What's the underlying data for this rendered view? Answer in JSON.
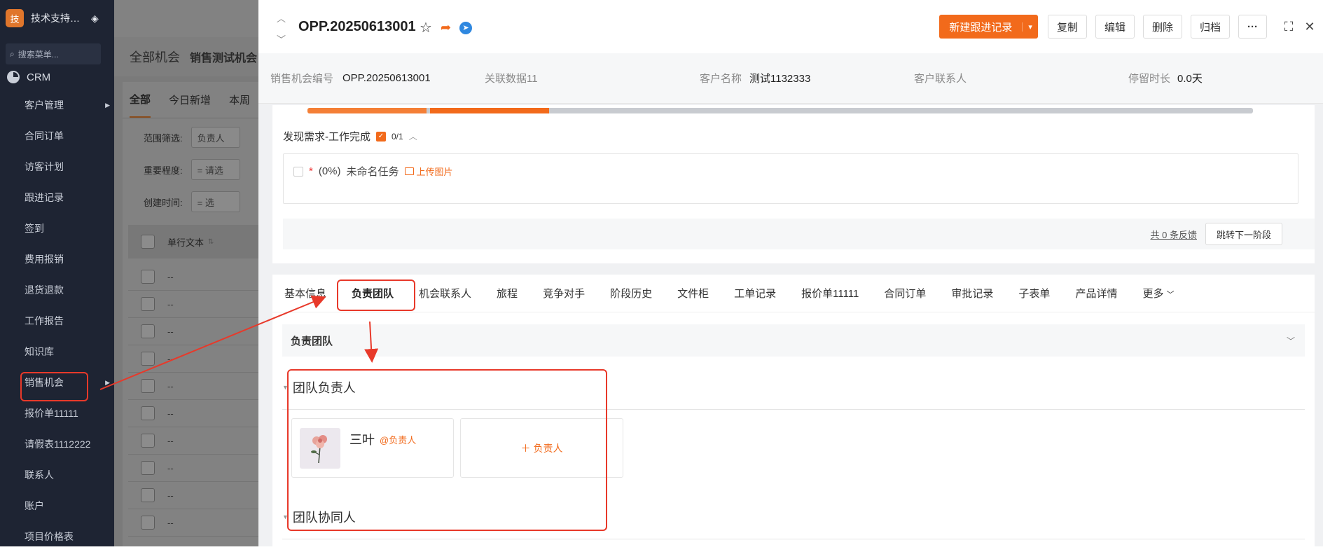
{
  "sidebar": {
    "logo_char": "技",
    "app_title": "技术支持…",
    "search_placeholder": "搜索菜单...",
    "module": "CRM",
    "items": [
      {
        "label": "客户管理"
      },
      {
        "label": "合同订单"
      },
      {
        "label": "访客计划"
      },
      {
        "label": "跟进记录"
      },
      {
        "label": "签到"
      },
      {
        "label": "费用报销"
      },
      {
        "label": "退货退款"
      },
      {
        "label": "工作报告"
      },
      {
        "label": "知识库"
      },
      {
        "label": "销售机会"
      },
      {
        "label": "报价单11111"
      },
      {
        "label": "请假表1112222"
      },
      {
        "label": "联系人"
      },
      {
        "label": "账户"
      },
      {
        "label": "项目价格表"
      }
    ]
  },
  "background": {
    "tabs": [
      "全部机会",
      "销售测试机会"
    ],
    "subtabs": [
      "全部",
      "今日新增",
      "本周"
    ],
    "filters": [
      {
        "label": "范围筛选:",
        "value": "负责人"
      },
      {
        "label": "重要程度:",
        "value": "= 请选"
      },
      {
        "label": "创建时间:",
        "value": "= 选"
      }
    ],
    "column_header": "单行文本",
    "row_value": "--"
  },
  "detail": {
    "title": "OPP.20250613001",
    "buttons": {
      "new_followup": "新建跟进记录",
      "copy": "复制",
      "edit": "编辑",
      "delete": "删除",
      "archive": "归档",
      "more": "···"
    },
    "info": [
      {
        "label": "销售机会编号",
        "value": "OPP.20250613001"
      },
      {
        "label": "关联数据11",
        "value": ""
      },
      {
        "label": "客户名称",
        "value": "测试1132333"
      },
      {
        "label": "客户联系人",
        "value": ""
      },
      {
        "label": "停留时长",
        "value": "0.0天"
      }
    ],
    "stage": {
      "title": "发现需求-工作完成",
      "count": "0/1",
      "task_percent": "(0%)",
      "task_name": "未命名任务",
      "upload_label": "上传图片",
      "feedback_link": "共 0 条反馈",
      "next_stage_button": "跳转下一阶段"
    },
    "tabs": [
      "基本信息",
      "负责团队",
      "机会联系人",
      "旅程",
      "竞争对手",
      "阶段历史",
      "文件柜",
      "工单记录",
      "报价单11111",
      "合同订单",
      "审批记录",
      "子表单",
      "产品详情",
      "更多"
    ],
    "active_tab": "负责团队",
    "team": {
      "section_title": "负责团队",
      "owner_heading": "团队负责人",
      "owner_name": "三叶",
      "owner_role": "@负责人",
      "add_owner": "负责人",
      "collab_heading": "团队协同人"
    }
  },
  "colors": {
    "accent": "#f26a1b",
    "sidebar_bg": "#1e2433",
    "annotation_red": "#e8392a"
  }
}
